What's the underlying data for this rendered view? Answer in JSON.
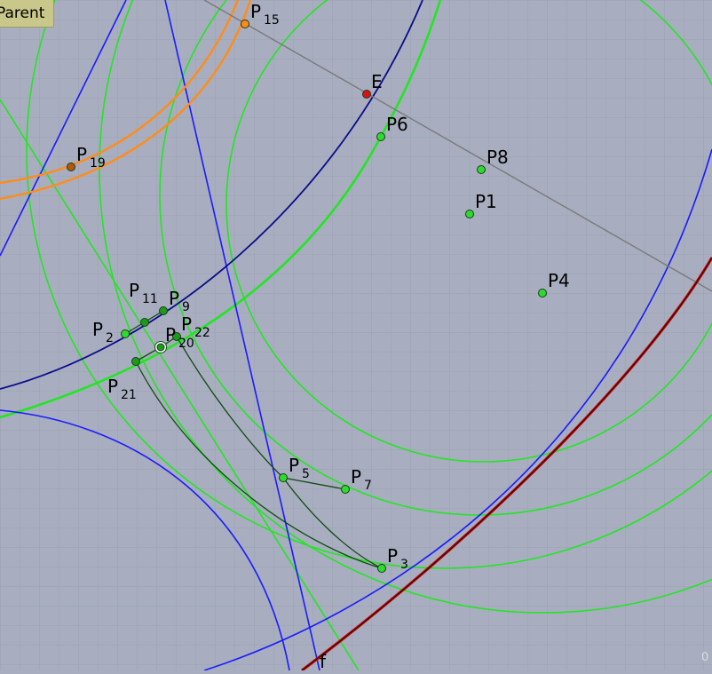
{
  "toolbar": {
    "parent_label": "Parent"
  },
  "colors": {
    "background": "#a8aebf",
    "grid": "#9aa1b3",
    "green_circle": "#22e622",
    "blue_line": "#1a1aff",
    "navy_curve": "#0b0b8c",
    "orange_curve": "#ff8c1a",
    "red_curve": "#cc0000",
    "gray_line": "#7a7a7a",
    "point_green": "#2ddb2d",
    "point_orange": "#ff8c1a",
    "point_red": "#dd1111",
    "point_brown": "#b05a10"
  },
  "points": [
    {
      "id": "E",
      "label": "E",
      "sub": "",
      "color": "red"
    },
    {
      "id": "P6",
      "label": "P6",
      "sub": "",
      "color": "green"
    },
    {
      "id": "P8",
      "label": "P8",
      "sub": "",
      "color": "green"
    },
    {
      "id": "P1",
      "label": "P1",
      "sub": "",
      "color": "green"
    },
    {
      "id": "P4",
      "label": "P4",
      "sub": "",
      "color": "green"
    },
    {
      "id": "P15",
      "label": "P",
      "sub": "15",
      "color": "orange"
    },
    {
      "id": "P19",
      "label": "P",
      "sub": "19",
      "color": "brown"
    },
    {
      "id": "P11",
      "label": "P",
      "sub": "11",
      "color": "darkgreen"
    },
    {
      "id": "P9",
      "label": "P",
      "sub": "9",
      "color": "darkgreen"
    },
    {
      "id": "P2",
      "label": "P",
      "sub": "2",
      "color": "green"
    },
    {
      "id": "P22",
      "label": "P",
      "sub": "22",
      "color": "darkgreen"
    },
    {
      "id": "P20",
      "label": "P",
      "sub": "20",
      "color": "selected"
    },
    {
      "id": "P21",
      "label": "P",
      "sub": "21",
      "color": "darkgreen"
    },
    {
      "id": "P5",
      "label": "P",
      "sub": "5",
      "color": "green"
    },
    {
      "id": "P7",
      "label": "P",
      "sub": "7",
      "color": "green"
    },
    {
      "id": "P3",
      "label": "P",
      "sub": "3",
      "color": "green"
    }
  ],
  "curve_labels": {
    "f": "f"
  },
  "corner_label": "0"
}
